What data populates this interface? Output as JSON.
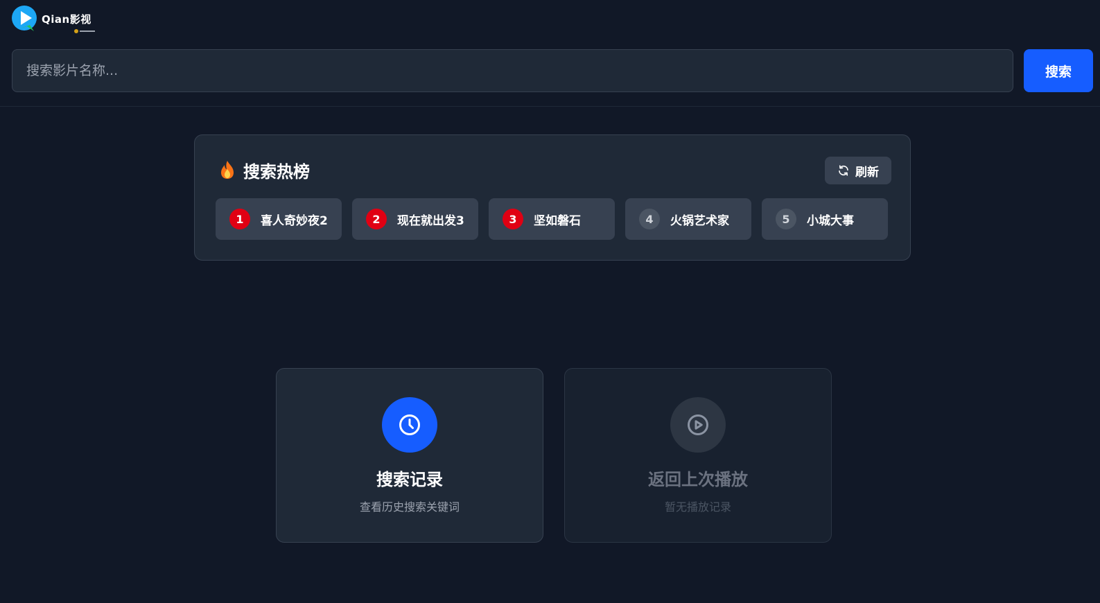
{
  "app": {
    "logo_text": "Qian影视",
    "logo_icon": "play-logo-icon"
  },
  "search": {
    "placeholder": "搜索影片名称...",
    "value": "",
    "button_label": "搜索"
  },
  "hot_search": {
    "title": "搜索热榜",
    "title_icon": "flame-icon",
    "refresh_label": "刷新",
    "refresh_icon": "refresh-icon",
    "items": [
      {
        "rank": "1",
        "label": "喜人奇妙夜2"
      },
      {
        "rank": "2",
        "label": "现在就出发3"
      },
      {
        "rank": "3",
        "label": "坚如磐石"
      },
      {
        "rank": "4",
        "label": "火锅艺术家"
      },
      {
        "rank": "5",
        "label": "小城大事"
      }
    ]
  },
  "cards": {
    "history": {
      "title": "搜索记录",
      "description": "查看历史搜索关键词",
      "icon": "clock-icon"
    },
    "resume": {
      "title": "返回上次播放",
      "description": "暂无播放记录",
      "icon": "play-circle-icon"
    }
  },
  "colors": {
    "background": "#111827",
    "panel": "#1f2937",
    "accent": "#165dff",
    "rank_top": "#e00013",
    "rank_other": "#4b5563"
  }
}
